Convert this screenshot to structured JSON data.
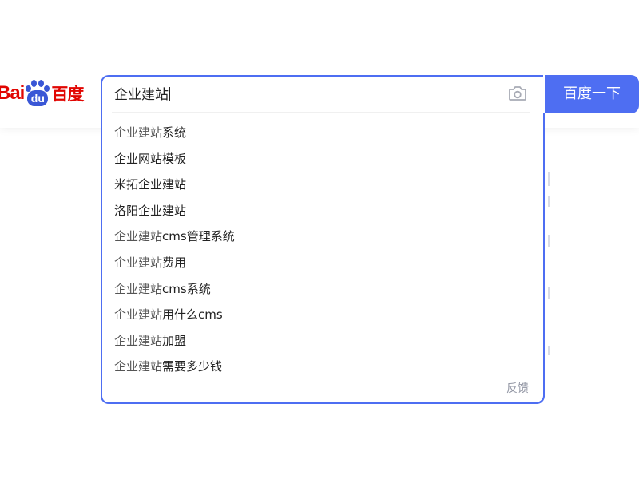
{
  "logo": {
    "bai": "Bai",
    "du": "du",
    "cn": "百度"
  },
  "search": {
    "query": "企业建站",
    "button_label": "百度一下",
    "camera_icon": "camera-icon"
  },
  "suggestions": [
    {
      "highlight": "企业建站",
      "rest": "系统"
    },
    {
      "highlight": "",
      "rest": "企业网站模板"
    },
    {
      "highlight": "",
      "rest": "米拓企业建站"
    },
    {
      "highlight": "",
      "rest": "洛阳企业建站"
    },
    {
      "highlight": "企业建站",
      "rest": "cms管理系统"
    },
    {
      "highlight": "企业建站",
      "rest": "费用"
    },
    {
      "highlight": "企业建站",
      "rest": "cms系统"
    },
    {
      "highlight": "企业建站",
      "rest": "用什么cms"
    },
    {
      "highlight": "企业建站",
      "rest": "加盟"
    },
    {
      "highlight": "企业建站",
      "rest": "需要多少钱"
    }
  ],
  "feedback_label": "反馈",
  "colors": {
    "accent": "#4e6ef2",
    "logo_red": "#e10602",
    "logo_blue": "#3a57d6"
  }
}
